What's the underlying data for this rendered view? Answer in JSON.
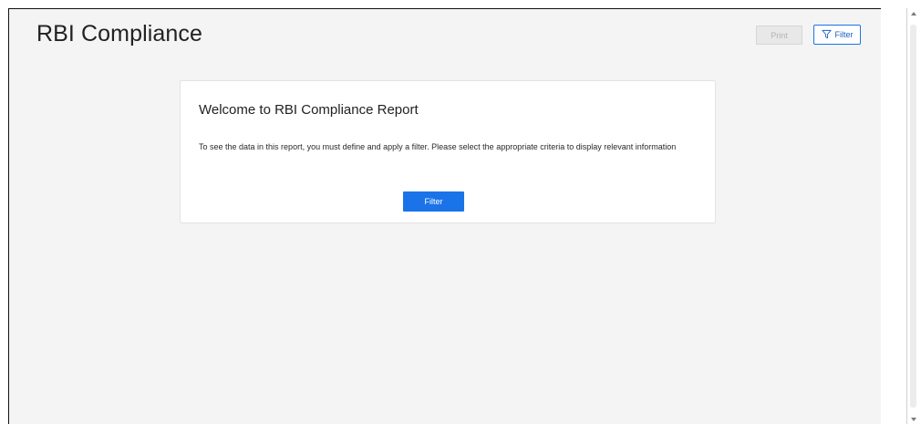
{
  "header": {
    "title": "RBI Compliance",
    "print_label": "Print",
    "filter_label": "Filter",
    "filter_icon": "filter-funnel-icon"
  },
  "welcome": {
    "heading": "Welcome to RBI Compliance Report",
    "message": "To see the data in this report, you must define and apply a filter. Please select the appropriate criteria to display relevant information",
    "filter_button_label": "Filter"
  },
  "colors": {
    "accent": "#1a73e8",
    "page_background": "#f4f4f4",
    "disabled_text": "#b3b3b3"
  }
}
